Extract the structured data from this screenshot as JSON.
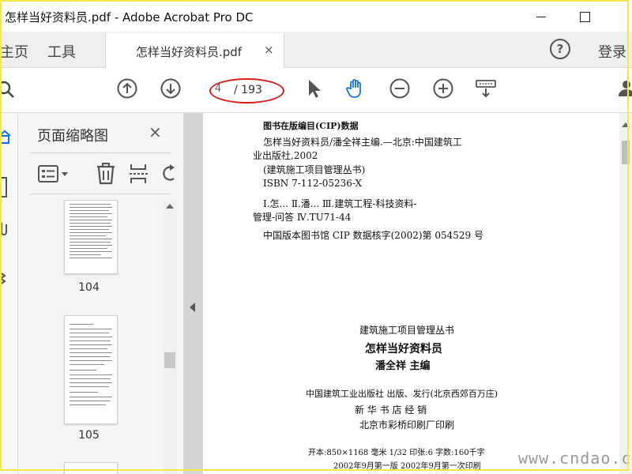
{
  "window": {
    "title": "怎样当好资料员.pdf - Adobe Acrobat Pro DC"
  },
  "tabs": {
    "home": "主页",
    "tools": "工具",
    "document": "怎样当好资料员.pdf",
    "close": "×"
  },
  "header_right": {
    "help": "?",
    "login": "登录"
  },
  "toolbar": {
    "current_page": "4",
    "total_pages": "/ 193"
  },
  "thumbnails_panel": {
    "title": "页面缩略图",
    "close": "×",
    "pages": [
      {
        "number": "104"
      },
      {
        "number": "105"
      }
    ]
  },
  "document_page": {
    "lines": [
      "图书在版编目(CIP)数据",
      "怎样当好资料员/潘全祥主编.—北京:中国建筑工",
      "业出版社,2002",
      "(建筑施工项目管理丛书)",
      "ISBN 7-112-05236-X",
      "Ⅰ.怎...  Ⅱ.潘...  Ⅲ.建筑工程-科技资料-",
      "管理-问答  Ⅳ.TU71-44",
      "中国版本图书馆 CIP 数据核字(2002)第 054529 号",
      "建筑施工项目管理丛书",
      "怎样当好资料员",
      "潘全祥  主编",
      "中国建筑工业出版社 出版、发行(北京西郊百万庄)",
      "新  华  书  店  经  销",
      "北京市彩桥印刷厂印刷",
      "开本:850×1168 毫米  1/32  印张:6  字数:160千字",
      "2002年9月第一版  2002年9月第一次印刷"
    ]
  },
  "watermark": "www.cndao.com",
  "colors": {
    "hand_tool": "#1473e6",
    "annotation_ellipse": "#d81e1e",
    "frame": "#f5e64a"
  },
  "icons": [
    "home-icon",
    "search-icon",
    "arrow-up-circle-icon",
    "arrow-down-circle-icon",
    "pointer-icon",
    "hand-icon",
    "zoom-out-icon",
    "zoom-in-icon",
    "keyboard-icon",
    "user-icon"
  ]
}
